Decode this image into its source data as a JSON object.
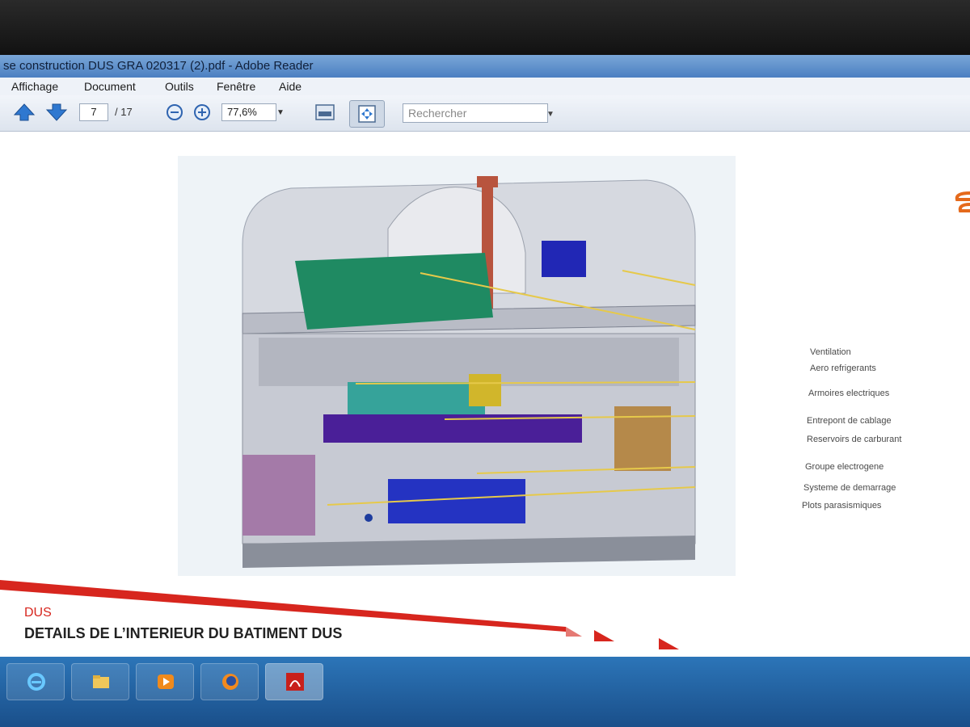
{
  "window": {
    "title": "se construction DUS GRA 020317 (2).pdf - Adobe Reader"
  },
  "menu": {
    "items": [
      "Affichage",
      "Document",
      "Outils",
      "Fenêtre",
      "Aide"
    ]
  },
  "toolbar": {
    "page_current": "7",
    "page_total": "/ 17",
    "zoom": "77,6%",
    "search_placeholder": "Rechercher"
  },
  "document": {
    "labels": [
      "Ventilation",
      "Aero refrigerants",
      "Armoires electriques",
      "Entrepont de cablage",
      "Reservoirs de carburant",
      "Groupe electrogene",
      "Systeme de demarrage",
      "Plots parasismiques"
    ],
    "section": "DUS",
    "heading": "DETAILS DE L’INTERIEUR DU BATIMENT DUS",
    "accent_color": "#d7261e"
  },
  "taskbar": {
    "apps": [
      "internet-explorer-icon",
      "folder-icon",
      "media-player-icon",
      "firefox-icon",
      "adobe-reader-icon"
    ]
  }
}
